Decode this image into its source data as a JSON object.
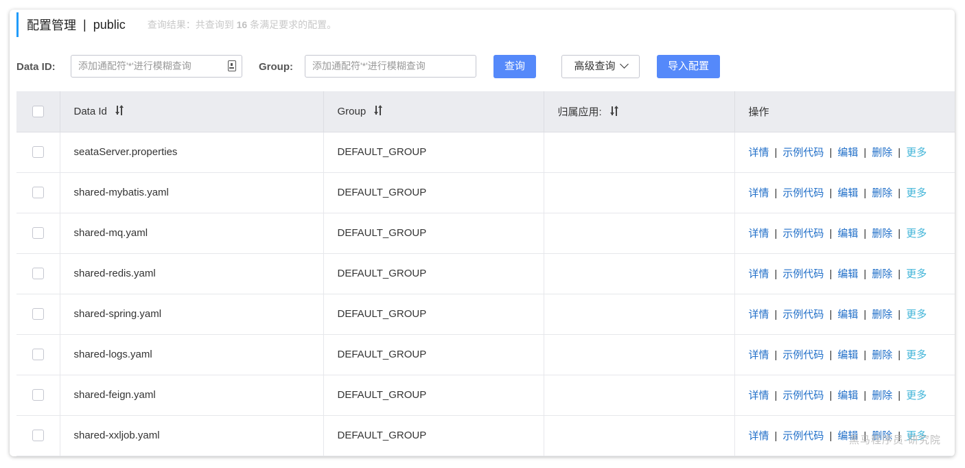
{
  "header": {
    "title": "配置管理",
    "separator": "|",
    "namespace": "public",
    "result_prefix": "查询结果：共查询到",
    "result_count": "16",
    "result_suffix": "条满足要求的配置。"
  },
  "search": {
    "data_id_label": "Data ID:",
    "data_id_placeholder": "添加通配符'*'进行模糊查询",
    "group_label": "Group:",
    "group_placeholder": "添加通配符'*'进行模糊查询",
    "query_button": "查询",
    "advanced_button": "高级查询",
    "import_button": "导入配置"
  },
  "table": {
    "headers": {
      "data_id": "Data Id",
      "group": "Group",
      "app": "归属应用:",
      "ops": "操作"
    },
    "op_labels": {
      "detail": "详情",
      "sample": "示例代码",
      "edit": "编辑",
      "delete": "删除",
      "more": "更多",
      "sep": "|"
    },
    "rows": [
      {
        "data_id": "seataServer.properties",
        "group": "DEFAULT_GROUP",
        "app": ""
      },
      {
        "data_id": "shared-mybatis.yaml",
        "group": "DEFAULT_GROUP",
        "app": ""
      },
      {
        "data_id": "shared-mq.yaml",
        "group": "DEFAULT_GROUP",
        "app": ""
      },
      {
        "data_id": "shared-redis.yaml",
        "group": "DEFAULT_GROUP",
        "app": ""
      },
      {
        "data_id": "shared-spring.yaml",
        "group": "DEFAULT_GROUP",
        "app": ""
      },
      {
        "data_id": "shared-logs.yaml",
        "group": "DEFAULT_GROUP",
        "app": ""
      },
      {
        "data_id": "shared-feign.yaml",
        "group": "DEFAULT_GROUP",
        "app": ""
      },
      {
        "data_id": "shared-xxljob.yaml",
        "group": "DEFAULT_GROUP",
        "app": ""
      }
    ]
  },
  "watermark": "黑马程序员-研究院",
  "colors": {
    "accent": "#209bfa",
    "primary_button": "#5589fa",
    "link": "#1f6ec8",
    "more_link": "#40b4d8",
    "header_bg": "#ebecf0"
  }
}
